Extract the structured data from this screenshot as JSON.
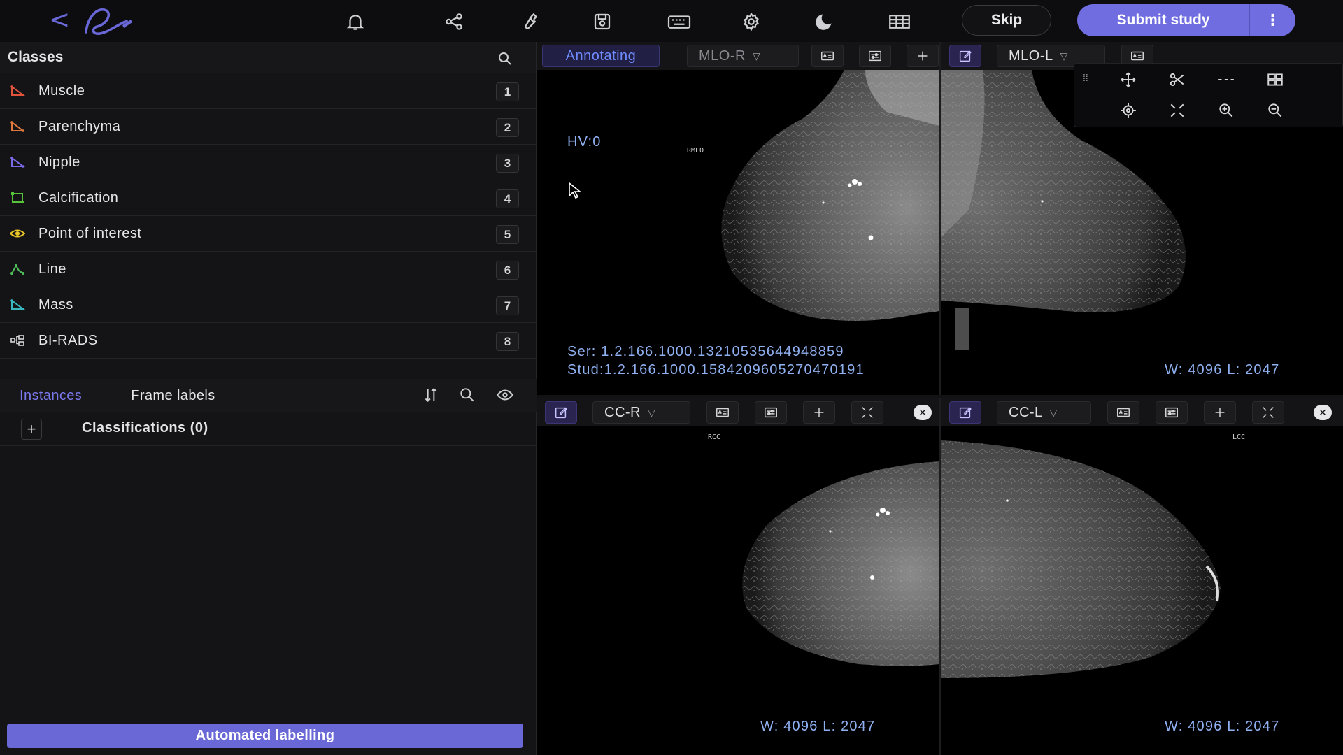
{
  "topbar": {
    "back": "<",
    "icons": [
      "bell-icon",
      "share-icon",
      "wrench-icon",
      "save-icon",
      "keyboard-icon",
      "gear-icon",
      "moon-icon",
      "grid-layout-icon"
    ],
    "skip_label": "Skip",
    "submit_label": "Submit study",
    "more_label": "⋮",
    "accent": "#6f6de0"
  },
  "classes": {
    "title": "Classes",
    "items": [
      {
        "label": "Muscle",
        "key": "1",
        "color": "#e0543c",
        "icon": "polygon-icon"
      },
      {
        "label": "Parenchyma",
        "key": "2",
        "color": "#e07a3c",
        "icon": "polygon-icon"
      },
      {
        "label": "Nipple",
        "key": "3",
        "color": "#7c6be8",
        "icon": "polygon-icon"
      },
      {
        "label": "Calcification",
        "key": "4",
        "color": "#58c23a",
        "icon": "bounding-box-icon"
      },
      {
        "label": "Point of interest",
        "key": "5",
        "color": "#e8c62a",
        "icon": "point-icon"
      },
      {
        "label": "Line",
        "key": "6",
        "color": "#4fbf5a",
        "icon": "polyline-icon"
      },
      {
        "label": "Mass",
        "key": "7",
        "color": "#39b7c0",
        "icon": "polygon-icon"
      },
      {
        "label": "BI-RADS",
        "key": "8",
        "color": "#d6d6d8",
        "icon": "classification-icon"
      }
    ]
  },
  "instances": {
    "tab_instances": "Instances",
    "tab_frame_labels": "Frame labels",
    "classifications_label": "Classifications (0)",
    "add_label": "+"
  },
  "automated_label": "Automated labelling",
  "viewports": {
    "mlo_r": {
      "status": "Annotating",
      "view": "MLO-R",
      "hv": "HV:0",
      "tag": "RMLO",
      "ser": "Ser: 1.2.166.1000.13210535644948859",
      "stud": "Stud:1.2.166.1000.1584209605270470191"
    },
    "mlo_l": {
      "view": "MLO-L",
      "wl": "W: 4096 L: 2047"
    },
    "cc_r": {
      "view": "CC-R",
      "tag": "RCC",
      "wl": "W: 4096 L: 2047"
    },
    "cc_l": {
      "view": "CC-L",
      "tag": "LCC",
      "wl": "W: 4096 L: 2047"
    }
  },
  "float_toolbar": {
    "row1": [
      "move-icon",
      "scissors-icon",
      "dashed-line-icon",
      "layout-icon"
    ],
    "row2": [
      "crosshair-icon",
      "fullscreen-icon",
      "zoom-in-icon",
      "zoom-out-icon"
    ]
  }
}
